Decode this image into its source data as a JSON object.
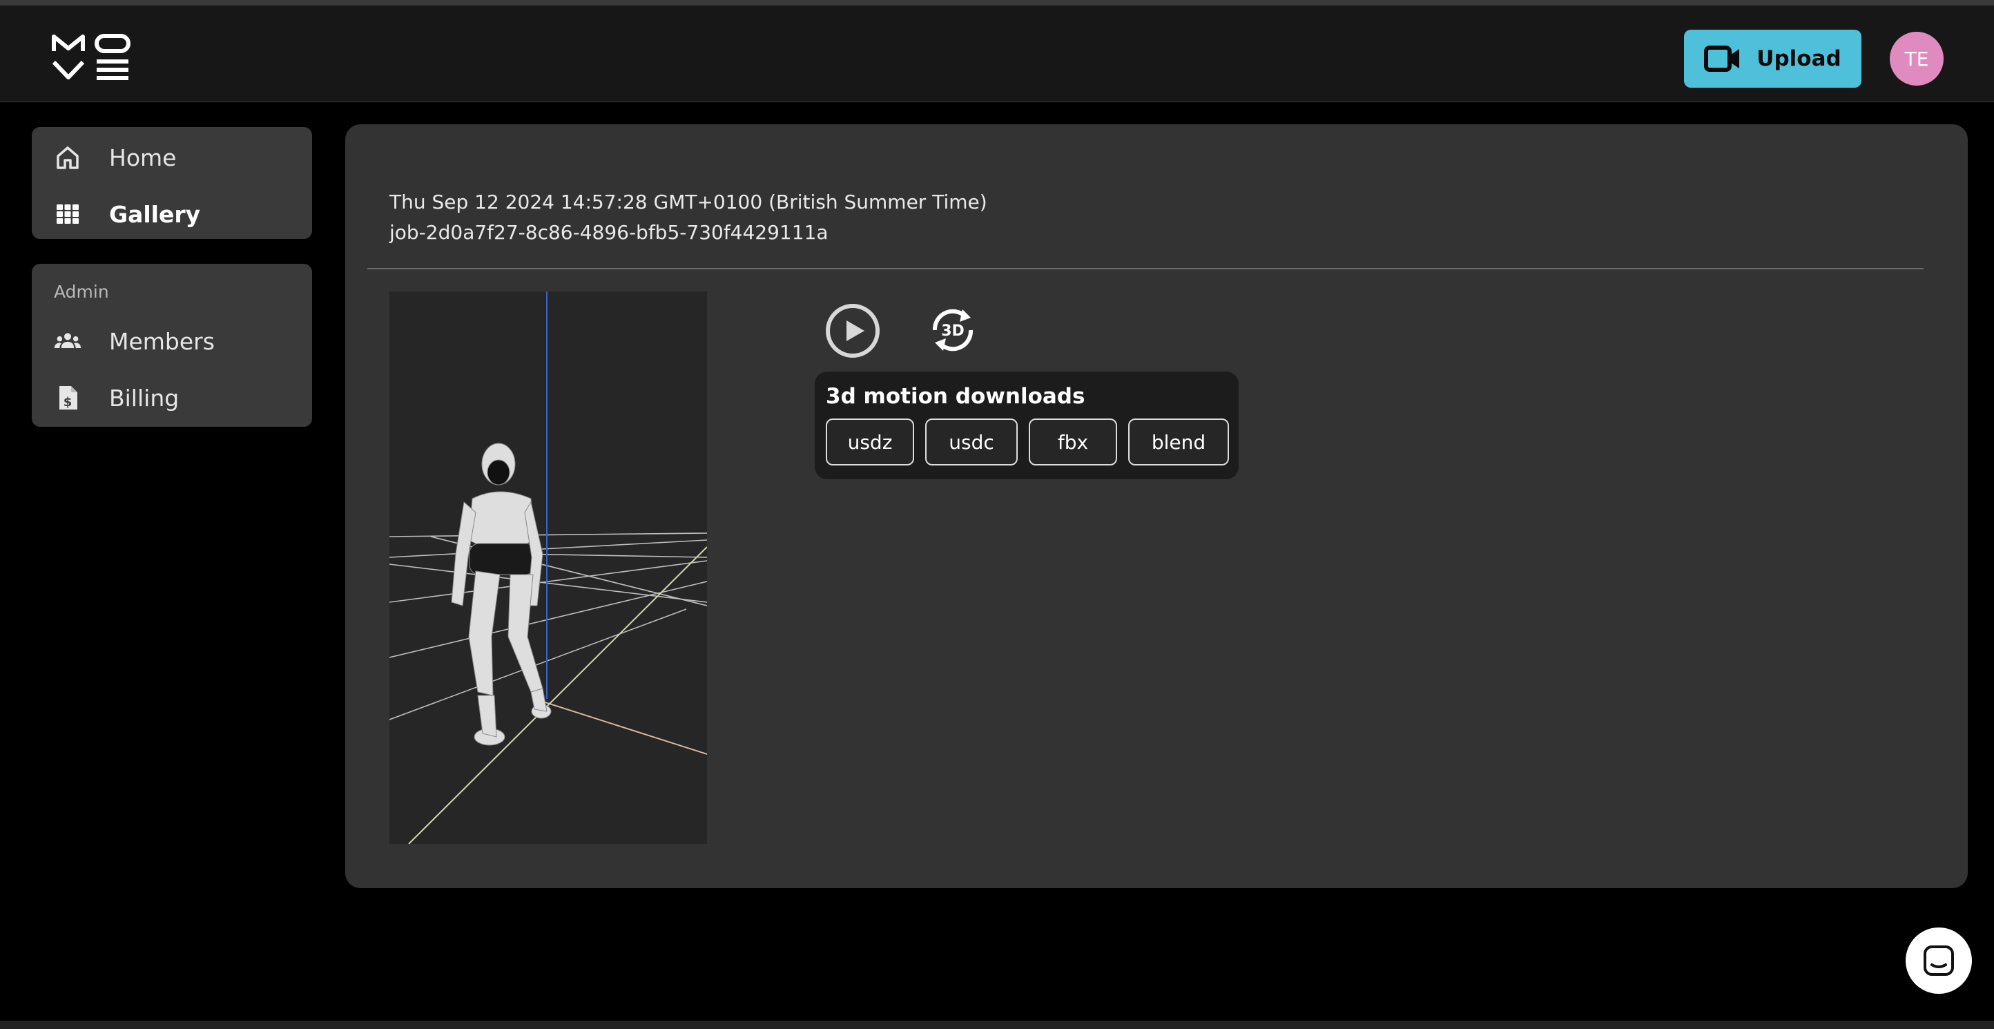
{
  "header": {
    "logo_text": "MOVE",
    "upload_label": "Upload",
    "avatar_initials": "TE",
    "upload_color": "#4fc0d9",
    "avatar_color": "#e08bc0"
  },
  "sidebar": {
    "main_items": [
      {
        "label": "Home",
        "icon": "home-icon"
      },
      {
        "label": "Gallery",
        "icon": "grid-icon",
        "active": true
      }
    ],
    "admin_title": "Admin",
    "admin_items": [
      {
        "label": "Members",
        "icon": "members-icon"
      },
      {
        "label": "Billing",
        "icon": "invoice-dollar-icon"
      }
    ]
  },
  "job": {
    "date": "Thu Sep 12 2024 14:57:28 GMT+0100 (British Summer Time)",
    "id": "job-2d0a7f27-8c86-4896-bfb5-730f4429111a"
  },
  "controls": {
    "play_icon": "play-circle-icon",
    "rotate_icon": "rotate-3d-icon",
    "rotate_text": "3D"
  },
  "downloads": {
    "title": "3d motion downloads",
    "formats": [
      "usdz",
      "usdc",
      "fbx",
      "blend"
    ]
  },
  "chat": {
    "icon": "chat-icon"
  }
}
